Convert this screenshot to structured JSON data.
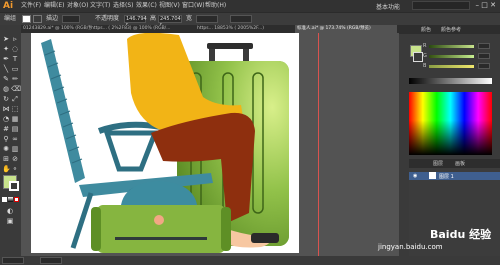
{
  "app": {
    "logo": "Ai"
  },
  "menu": {
    "items": [
      "文件(F)",
      "编辑(E)",
      "对象(O)",
      "文字(T)",
      "选择(S)",
      "效果(C)",
      "视图(V)",
      "窗口(W)",
      "帮助(H)"
    ],
    "workspace": "基本功能"
  },
  "window_controls": {
    "minimize": "–",
    "maximize": "□",
    "close": "✕"
  },
  "controlbar": {
    "selection_label": "编组",
    "stroke_label": "描边",
    "opacity_label": "不透明度",
    "x_value": "146.794 r",
    "y_value": "245.704 r",
    "w_label": "宽",
    "h_label": "高"
  },
  "tabs": [
    {
      "label": "01243829.ai* @ 100% (RGB/预览)",
      "active": false
    },
    {
      "label": "https... ( 2%2F83) @ 100% (RGB/...",
      "active": false
    },
    {
      "label": "https... 18853% ( 2005%2F...)",
      "active": false
    },
    {
      "label": "标准人.ai* @ 173.74% (RGB/预览)",
      "active": true
    }
  ],
  "colors": {
    "suitcase": "#7fae3d",
    "suitcase_light": "#b7dc6a",
    "suitcase_dark": "#4e7a1f",
    "chair": "#3f8b9f",
    "chair_dark": "#2e6f82",
    "shirt": "#f2b416",
    "pants": "#8e2f0e",
    "bag_green": "#86b540",
    "bag_teal": "#3d8ca0",
    "shoe": "#f7c7a1",
    "fill_swatch": "#c8e38c"
  },
  "right_panel": {
    "tabs": [
      "颜色",
      "颜色参考"
    ],
    "sliders": [
      {
        "label": "R",
        "color": "#8a9d44",
        "value": ""
      },
      {
        "label": "G",
        "color": "#99cc55",
        "value": ""
      },
      {
        "label": "B",
        "color": "#d9cc77",
        "value": ""
      }
    ],
    "layers_tabs": [
      "图层",
      "画板"
    ],
    "layer_name": "图层 1"
  },
  "watermark": {
    "text": "Baidu 经验",
    "url": "jingyan.baidu.com"
  }
}
